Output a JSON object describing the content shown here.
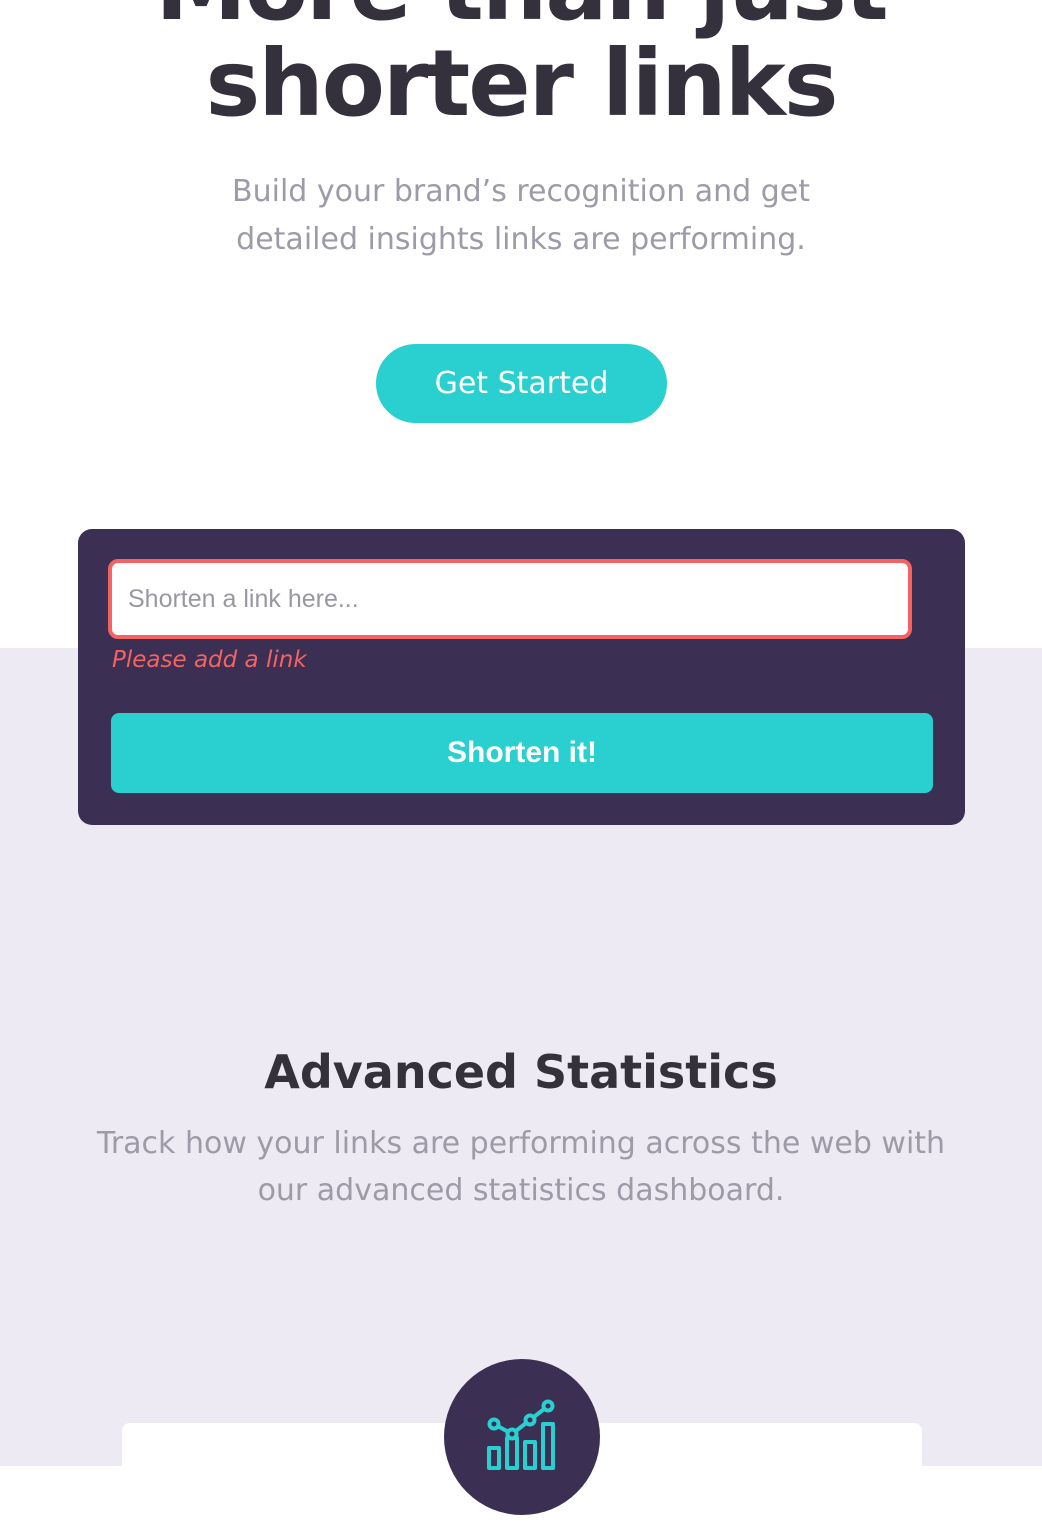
{
  "hero": {
    "title_line_1": "More than just",
    "title_line_2": "shorter links",
    "subtitle": "Build your brand’s recognition and get detailed insights links are performing.",
    "cta_label": "Get Started"
  },
  "shorten": {
    "placeholder": "Shorten a link here...",
    "value": "",
    "error": "Please add a link",
    "button_label": "Shorten it!"
  },
  "statistics": {
    "title": "Advanced Statistics",
    "subtitle_line_1": "Track how your links are performing across the web with",
    "subtitle_line_2": "our advanced statistics dashboard."
  },
  "feature": {
    "icon": "chart-icon"
  },
  "colors": {
    "accent": "#2acfcf",
    "dark_violet": "#3b3054",
    "error": "#f46262",
    "text_dark": "#34313d",
    "text_gray": "#9e9aa8",
    "section_bg": "#eeeaf4"
  }
}
